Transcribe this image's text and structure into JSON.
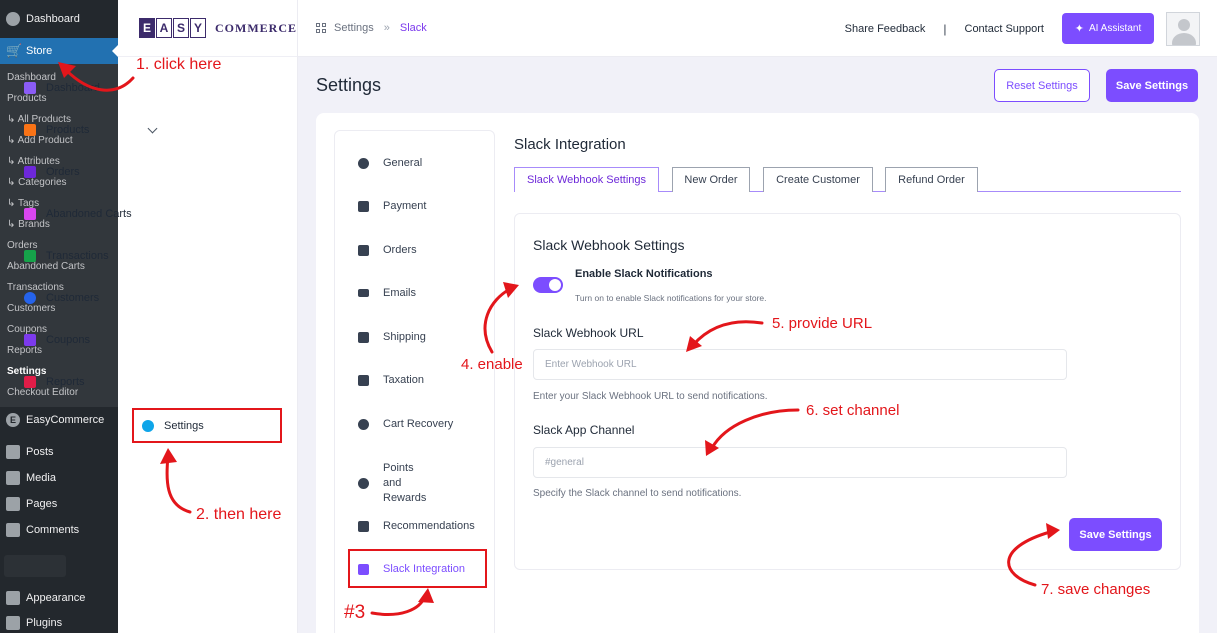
{
  "wp_menu": {
    "dashboard": "Dashboard",
    "store": "Store",
    "store_sub": [
      "Dashboard",
      "Products",
      "↳ All Products",
      "↳ Add Product",
      "↳ Attributes",
      "↳ Categories",
      "↳ Tags",
      "↳ Brands",
      "Orders",
      "Abandoned Carts",
      "Transactions",
      "Customers",
      "Coupons",
      "Reports",
      "Settings",
      "Checkout Editor"
    ],
    "easycommerce": "EasyCommerce",
    "posts": "Posts",
    "media": "Media",
    "pages": "Pages",
    "comments": "Comments",
    "appearance": "Appearance",
    "plugins": "Plugins"
  },
  "brand": {
    "letters": [
      "E",
      "A",
      "S",
      "Y"
    ],
    "word": "COMMERCE"
  },
  "ec_nav": {
    "items": [
      {
        "label": "Dashboard",
        "icon": "dashboard-icon",
        "color": "#8b5cf6"
      },
      {
        "label": "Products",
        "icon": "box-icon",
        "color": "#f97316"
      },
      {
        "label": "Orders",
        "icon": "bag-icon",
        "color": "#6d28d9"
      },
      {
        "label": "Abandoned Carts",
        "icon": "cart-icon",
        "color": "#d946ef"
      },
      {
        "label": "Transactions",
        "icon": "cash-icon",
        "color": "#16a34a"
      },
      {
        "label": "Customers",
        "icon": "users-icon",
        "color": "#2563eb"
      },
      {
        "label": "Coupons",
        "icon": "ticket-icon",
        "color": "#7c3aed"
      },
      {
        "label": "Reports",
        "icon": "report-icon",
        "color": "#e11d48"
      },
      {
        "label": "Settings",
        "icon": "gear-icon",
        "color": "#0ea5e9"
      }
    ]
  },
  "topbar": {
    "crumb_root": "Settings",
    "crumb_sep": "»",
    "crumb_current": "Slack",
    "share_feedback": "Share Feedback",
    "divider": "|",
    "contact_support": "Contact Support",
    "ai_assistant": "AI Assistant"
  },
  "page": {
    "title": "Settings",
    "reset_label": "Reset Settings",
    "save_label": "Save Settings"
  },
  "settings_nav": [
    "General",
    "Payment",
    "Orders",
    "Emails",
    "Shipping",
    "Taxation",
    "Cart Recovery",
    "Points and Rewards",
    "Recommendations",
    "Slack Integration"
  ],
  "content": {
    "title": "Slack Integration",
    "tabs": [
      "Slack Webhook Settings",
      "New Order",
      "Create Customer",
      "Refund Order"
    ],
    "card_title": "Slack Webhook Settings",
    "toggle_label": "Enable Slack Notifications",
    "toggle_help": "Turn on to enable Slack notifications for your store.",
    "toggle_on": true,
    "webhook_label": "Slack Webhook URL",
    "webhook_placeholder": "Enter Webhook URL",
    "webhook_help": "Enter your Slack Webhook URL to send notifications.",
    "channel_label": "Slack App Channel",
    "channel_placeholder": "#general",
    "channel_help": "Specify the Slack channel to send notifications.",
    "save_label": "Save Settings"
  },
  "annotations": {
    "a1": "1. click here",
    "a2": "2. then here",
    "a3": "#3",
    "a4": "4. enable",
    "a5": "5. provide URL",
    "a6": "6. set channel",
    "a7": "7. save changes"
  },
  "colors": {
    "accent": "#7c4dff",
    "annotation": "#e3161b",
    "wp_sidebar": "#23282d",
    "wp_active": "#2271b1"
  }
}
